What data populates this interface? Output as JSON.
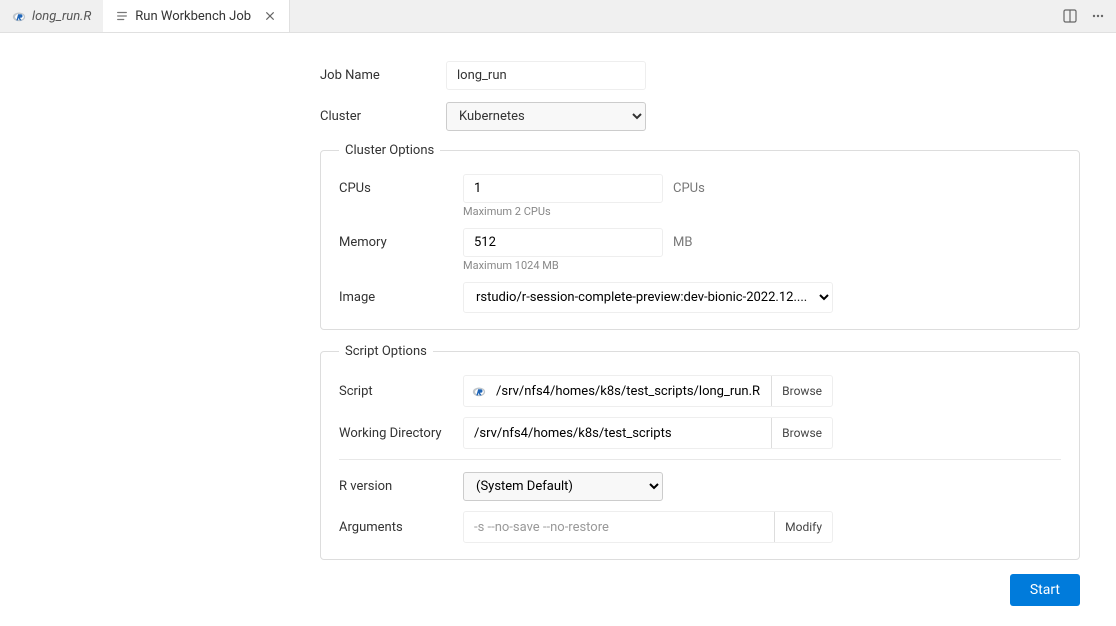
{
  "tabs": {
    "file": {
      "label": "long_run.R"
    },
    "workbench": {
      "label": "Run Workbench Job"
    }
  },
  "form": {
    "jobname_label": "Job Name",
    "jobname_value": "long_run",
    "cluster_label": "Cluster",
    "cluster_value": "Kubernetes"
  },
  "cluster_options": {
    "legend": "Cluster Options",
    "cpus_label": "CPUs",
    "cpus_value": "1",
    "cpus_unit": "CPUs",
    "cpus_hint": "Maximum 2 CPUs",
    "memory_label": "Memory",
    "memory_value": "512",
    "memory_unit": "MB",
    "memory_hint": "Maximum 1024 MB",
    "image_label": "Image",
    "image_value": "rstudio/r-session-complete-preview:dev-bionic-2022.12...."
  },
  "script_options": {
    "legend": "Script Options",
    "script_label": "Script",
    "script_value": "/srv/nfs4/homes/k8s/test_scripts/long_run.R",
    "browse_label": "Browse",
    "wd_label": "Working Directory",
    "wd_value": "/srv/nfs4/homes/k8s/test_scripts",
    "rversion_label": "R version",
    "rversion_value": "(System Default)",
    "args_label": "Arguments",
    "args_value": "-s --no-save --no-restore",
    "modify_label": "Modify"
  },
  "footer": {
    "start_label": "Start"
  }
}
